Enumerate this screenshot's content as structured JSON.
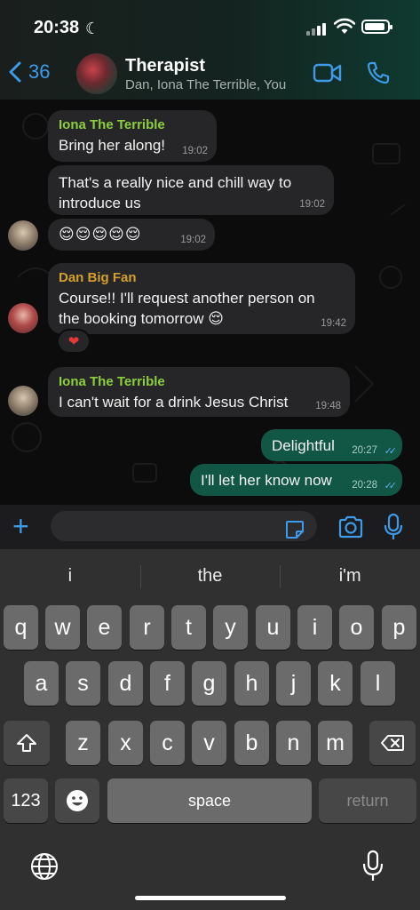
{
  "status_bar": {
    "time": "20:38"
  },
  "header": {
    "back_count": "36",
    "title": "Therapist",
    "subtitle": "Dan, Iona The Terrible, You"
  },
  "messages": [
    {
      "sender": "Iona The Terrible",
      "text": "Bring her along!",
      "time": "19:02"
    },
    {
      "text": "That's a really nice and chill way to introduce us",
      "time": "19:02"
    },
    {
      "text": "😌😌😌😌😌",
      "time": "19:02"
    },
    {
      "sender": "Dan Big Fan",
      "text": "Course!! I'll request another person on the booking tomorrow 😌",
      "time": "19:42",
      "reaction": "❤"
    },
    {
      "sender": "Iona The Terrible",
      "text": "I can't wait for a drink Jesus Christ",
      "time": "19:48"
    },
    {
      "text": "Delightful",
      "time": "20:27",
      "outgoing": true
    },
    {
      "text": "I'll let her know now",
      "time": "20:28",
      "outgoing": true
    }
  ],
  "input": {
    "plus": "+"
  },
  "keyboard": {
    "suggestions": [
      "i",
      "the",
      "i'm"
    ],
    "row1": [
      "q",
      "w",
      "e",
      "r",
      "t",
      "y",
      "u",
      "i",
      "o",
      "p"
    ],
    "row2": [
      "a",
      "s",
      "d",
      "f",
      "g",
      "h",
      "j",
      "k",
      "l"
    ],
    "row3": [
      "z",
      "x",
      "c",
      "v",
      "b",
      "n",
      "m"
    ],
    "numbers_label": "123",
    "space_label": "space",
    "return_label": "return"
  },
  "colors": {
    "accent": "#3d9be9",
    "outgoing_bubble": "#125646",
    "incoming_bubble": "#262628",
    "sender_lime": "#8ccf3d",
    "sender_gold": "#d4a02b"
  }
}
